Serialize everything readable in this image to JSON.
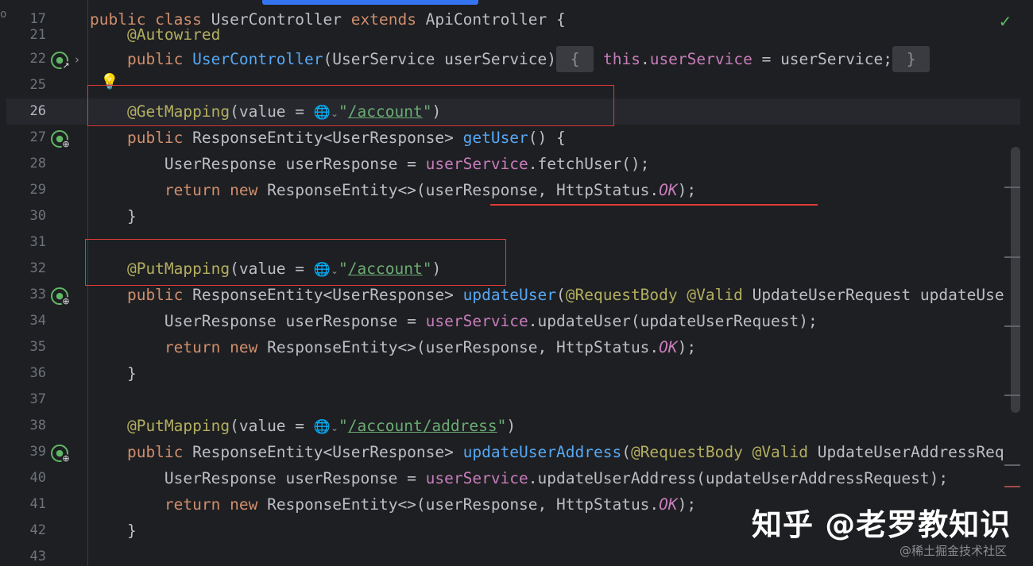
{
  "editor": {
    "lines": [
      {
        "n": "17",
        "tokens": [
          [
            "kw",
            "public "
          ],
          [
            "kw",
            "class "
          ],
          [
            "dim",
            "UserController "
          ],
          [
            "kw",
            "extends "
          ],
          [
            "dim",
            "ApiController {"
          ]
        ]
      },
      {
        "n": "21",
        "tokens": [
          [
            "ann",
            "    @Autowired"
          ]
        ]
      },
      {
        "n": "22",
        "tokens": [
          [
            "kw",
            "    public "
          ],
          [
            "fn",
            "UserController"
          ],
          [
            "dim",
            "(UserService userService)"
          ],
          [
            "fold",
            " { "
          ],
          [
            "field",
            " this"
          ],
          [
            "dim",
            "."
          ],
          [
            "field",
            "userService"
          ],
          [
            "dim",
            " = userService;"
          ],
          [
            "fold",
            " } "
          ]
        ]
      },
      {
        "n": "25",
        "tokens": [
          [
            "dim",
            ""
          ]
        ]
      },
      {
        "n": "26",
        "tokens": [
          [
            "ann",
            "    @GetMapping"
          ],
          [
            "dim",
            "(value = "
          ],
          [
            "globe",
            "🌐"
          ],
          [
            "caret",
            "⌄"
          ],
          [
            "str",
            "\""
          ],
          [
            "stru",
            "/account"
          ],
          [
            "str",
            "\""
          ],
          [
            "dim",
            ")"
          ]
        ]
      },
      {
        "n": "27",
        "tokens": [
          [
            "kw",
            "    public "
          ],
          [
            "dim",
            "ResponseEntity<UserResponse> "
          ],
          [
            "fn",
            "getUser"
          ],
          [
            "dim",
            "() {"
          ]
        ]
      },
      {
        "n": "28",
        "tokens": [
          [
            "dim",
            "        UserResponse userResponse = "
          ],
          [
            "field",
            "userService"
          ],
          [
            "dim",
            ".fetchUser();"
          ]
        ]
      },
      {
        "n": "29",
        "tokens": [
          [
            "kw",
            "        return "
          ],
          [
            "kw",
            "new "
          ],
          [
            "dim",
            "ResponseEntity<>(userResponse, HttpStatus."
          ],
          [
            "italic",
            "OK"
          ],
          [
            "dim",
            ");"
          ]
        ]
      },
      {
        "n": "30",
        "tokens": [
          [
            "dim",
            "    }"
          ]
        ]
      },
      {
        "n": "31",
        "tokens": [
          [
            "dim",
            ""
          ]
        ]
      },
      {
        "n": "32",
        "tokens": [
          [
            "ann",
            "    @PutMapping"
          ],
          [
            "dim",
            "(value = "
          ],
          [
            "globe",
            "🌐"
          ],
          [
            "caret",
            "⌄"
          ],
          [
            "str",
            "\""
          ],
          [
            "stru",
            "/account"
          ],
          [
            "str",
            "\""
          ],
          [
            "dim",
            ")"
          ]
        ]
      },
      {
        "n": "33",
        "tokens": [
          [
            "kw",
            "    public "
          ],
          [
            "dim",
            "ResponseEntity<UserResponse> "
          ],
          [
            "fn",
            "updateUser"
          ],
          [
            "dim",
            "("
          ],
          [
            "ann",
            "@RequestBody "
          ],
          [
            "ann",
            "@Valid "
          ],
          [
            "dim",
            "UpdateUserRequest updateUse"
          ]
        ]
      },
      {
        "n": "34",
        "tokens": [
          [
            "dim",
            "        UserResponse userResponse = "
          ],
          [
            "field",
            "userService"
          ],
          [
            "dim",
            ".updateUser(updateUserRequest);"
          ]
        ]
      },
      {
        "n": "35",
        "tokens": [
          [
            "kw",
            "        return "
          ],
          [
            "kw",
            "new "
          ],
          [
            "dim",
            "ResponseEntity<>(userResponse, HttpStatus."
          ],
          [
            "italic",
            "OK"
          ],
          [
            "dim",
            ");"
          ]
        ]
      },
      {
        "n": "36",
        "tokens": [
          [
            "dim",
            "    }"
          ]
        ]
      },
      {
        "n": "37",
        "tokens": [
          [
            "dim",
            ""
          ]
        ]
      },
      {
        "n": "38",
        "tokens": [
          [
            "ann",
            "    @PutMapping"
          ],
          [
            "dim",
            "(value = "
          ],
          [
            "globe",
            "🌐"
          ],
          [
            "caret",
            "⌄"
          ],
          [
            "str",
            "\""
          ],
          [
            "stru",
            "/account"
          ],
          [
            "stru",
            "/address"
          ],
          [
            "str",
            "\""
          ],
          [
            "dim",
            ")"
          ]
        ]
      },
      {
        "n": "39",
        "tokens": [
          [
            "kw",
            "    public "
          ],
          [
            "dim",
            "ResponseEntity<UserResponse> "
          ],
          [
            "fn",
            "updateUserAddress"
          ],
          [
            "dim",
            "("
          ],
          [
            "ann",
            "@RequestBody "
          ],
          [
            "ann",
            "@Valid "
          ],
          [
            "dim",
            "UpdateUserAddressReq"
          ]
        ]
      },
      {
        "n": "40",
        "tokens": [
          [
            "dim",
            "        UserResponse userResponse = "
          ],
          [
            "field",
            "userService"
          ],
          [
            "dim",
            ".updateUserAddress(updateUserAddressRequest);"
          ]
        ]
      },
      {
        "n": "41",
        "tokens": [
          [
            "kw",
            "        return "
          ],
          [
            "kw",
            "new "
          ],
          [
            "dim",
            "ResponseEntity<>(userResponse, HttpStatus."
          ],
          [
            "italic",
            "OK"
          ],
          [
            "dim",
            ");"
          ]
        ]
      },
      {
        "n": "42",
        "tokens": [
          [
            "dim",
            "    }"
          ]
        ]
      },
      {
        "n": "43",
        "tokens": [
          [
            "dim",
            ""
          ]
        ]
      }
    ]
  },
  "watermark": {
    "main": "知乎 @老罗教知识",
    "sub": "@稀土掘金技术社区"
  },
  "colors": {
    "background": "#1e1f22",
    "keyword": "#cf8e6d",
    "annotation": "#b3ae60",
    "function": "#56a8f5",
    "field": "#c77dbb",
    "string": "#6aab73",
    "highlight_red": "#e03a3a"
  },
  "icons": {
    "status": "check-icon",
    "gutter_override": "implementation-arrow-icon",
    "gutter_endpoint": "web-endpoint-icon",
    "intention": "lightbulb-icon",
    "url": "globe-icon"
  }
}
